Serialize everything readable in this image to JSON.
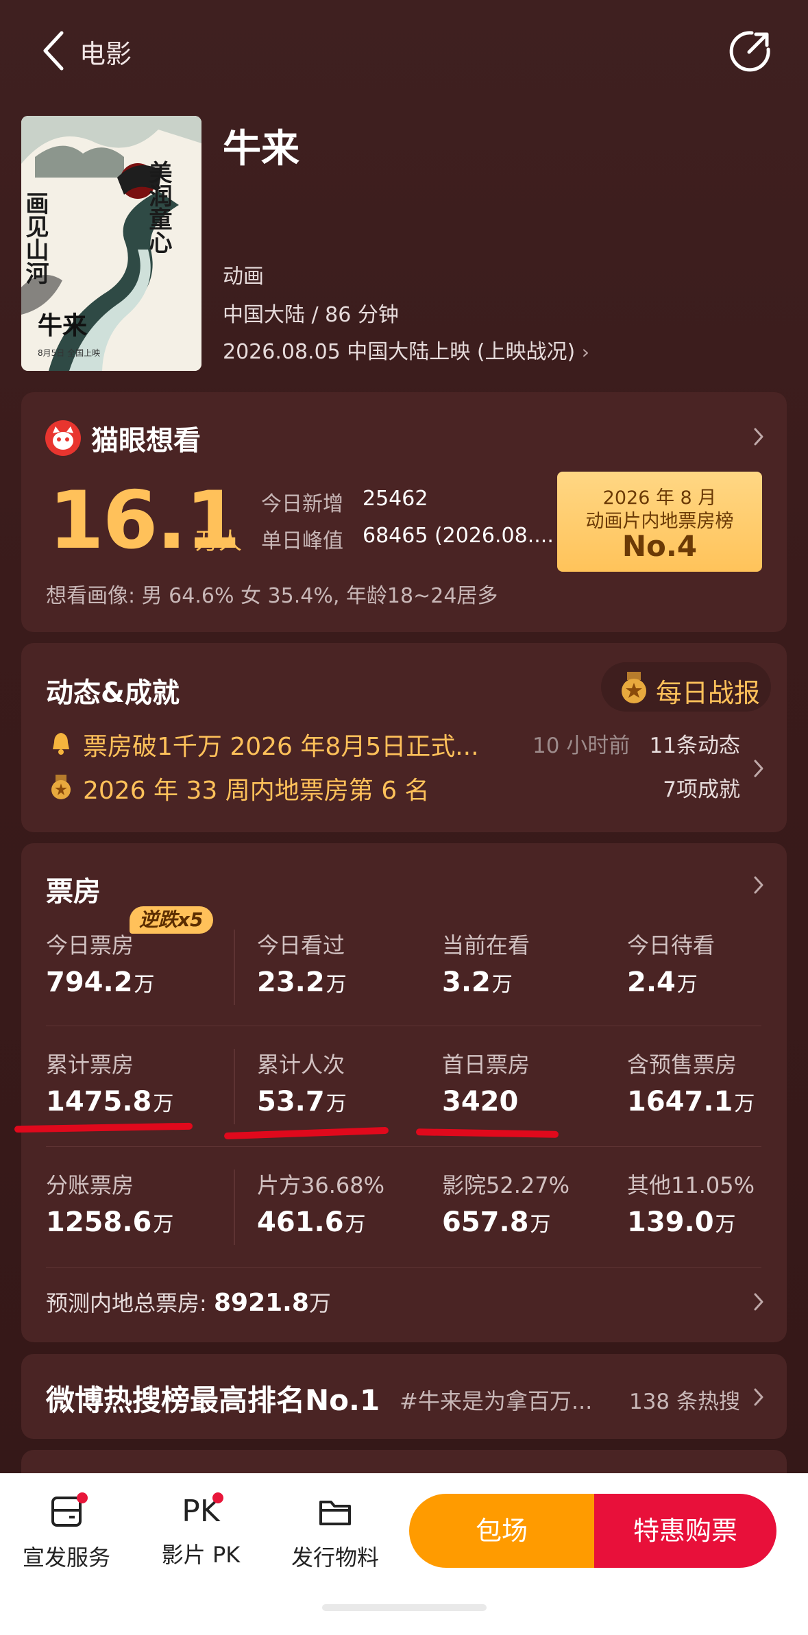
{
  "header": {
    "title": "电影"
  },
  "movie": {
    "title": "牛来",
    "genre": "动画",
    "region_duration": "中国大陆 / 86 分钟",
    "release": "2026.08.05 中国大陆上映 (上映战况)",
    "poster": {
      "text_left": "画见山河",
      "text_right": "美润童心",
      "title": "牛来",
      "date": "8月5日 全国上映"
    }
  },
  "want": {
    "title": "猫眼想看",
    "count": "16.1",
    "unit": "万人",
    "today_new_label": "今日新增",
    "today_new_value": "25462",
    "peak_label": "单日峰值",
    "peak_value": "68465 (2026.08....",
    "rank_line1": "2026 年 8 月",
    "rank_line2": "动画片内地票房榜",
    "rank_no": "No.4",
    "portrait": "想看画像: 男 64.6%  女 35.4%, 年龄18~24居多"
  },
  "news": {
    "title": "动态&成就",
    "daily_label": "每日战报",
    "item1": "票房破1千万 2026 年8月5日正式...",
    "item1_time": "10 小时前",
    "item1_count": "11条动态",
    "item2": "2026 年 33 周内地票房第 6 名",
    "item2_count": "7项成就"
  },
  "box": {
    "title": "票房",
    "badge": "逆跌x5",
    "cells": [
      {
        "label": "今日票房",
        "value": "794.2",
        "unit": "万"
      },
      {
        "label": "今日看过",
        "value": "23.2",
        "unit": "万"
      },
      {
        "label": "当前在看",
        "value": "3.2",
        "unit": "万"
      },
      {
        "label": "今日待看",
        "value": "2.4",
        "unit": "万"
      },
      {
        "label": "累计票房",
        "value": "1475.8",
        "unit": "万"
      },
      {
        "label": "累计人次",
        "value": "53.7",
        "unit": "万"
      },
      {
        "label": "首日票房",
        "value": "3420",
        "unit": ""
      },
      {
        "label": "含预售票房",
        "value": "1647.1",
        "unit": "万"
      },
      {
        "label": "分账票房",
        "value": "1258.6",
        "unit": "万"
      },
      {
        "label": "片方36.68%",
        "value": "461.6",
        "unit": "万"
      },
      {
        "label": "影院52.27%",
        "value": "657.8",
        "unit": "万"
      },
      {
        "label": "其他11.05%",
        "value": "139.0",
        "unit": "万"
      }
    ],
    "forecast_label": "预测内地总票房:",
    "forecast_value": "8921.8",
    "forecast_unit": "万"
  },
  "weibo": {
    "title": "微博热搜榜最高排名No.1",
    "tag": "#牛来是为拿百万...",
    "count": "138 条热搜"
  },
  "bottom": {
    "tool1": "宣发服务",
    "tool2_icon": "PK",
    "tool2": "影片 PK",
    "tool3": "发行物料",
    "booking": "包场",
    "buy": "特惠购票"
  },
  "colors": {
    "accent": "#ffc15a",
    "buy": "#e8103a",
    "booking": "#ff9b00",
    "background": "#3b1c1c"
  }
}
